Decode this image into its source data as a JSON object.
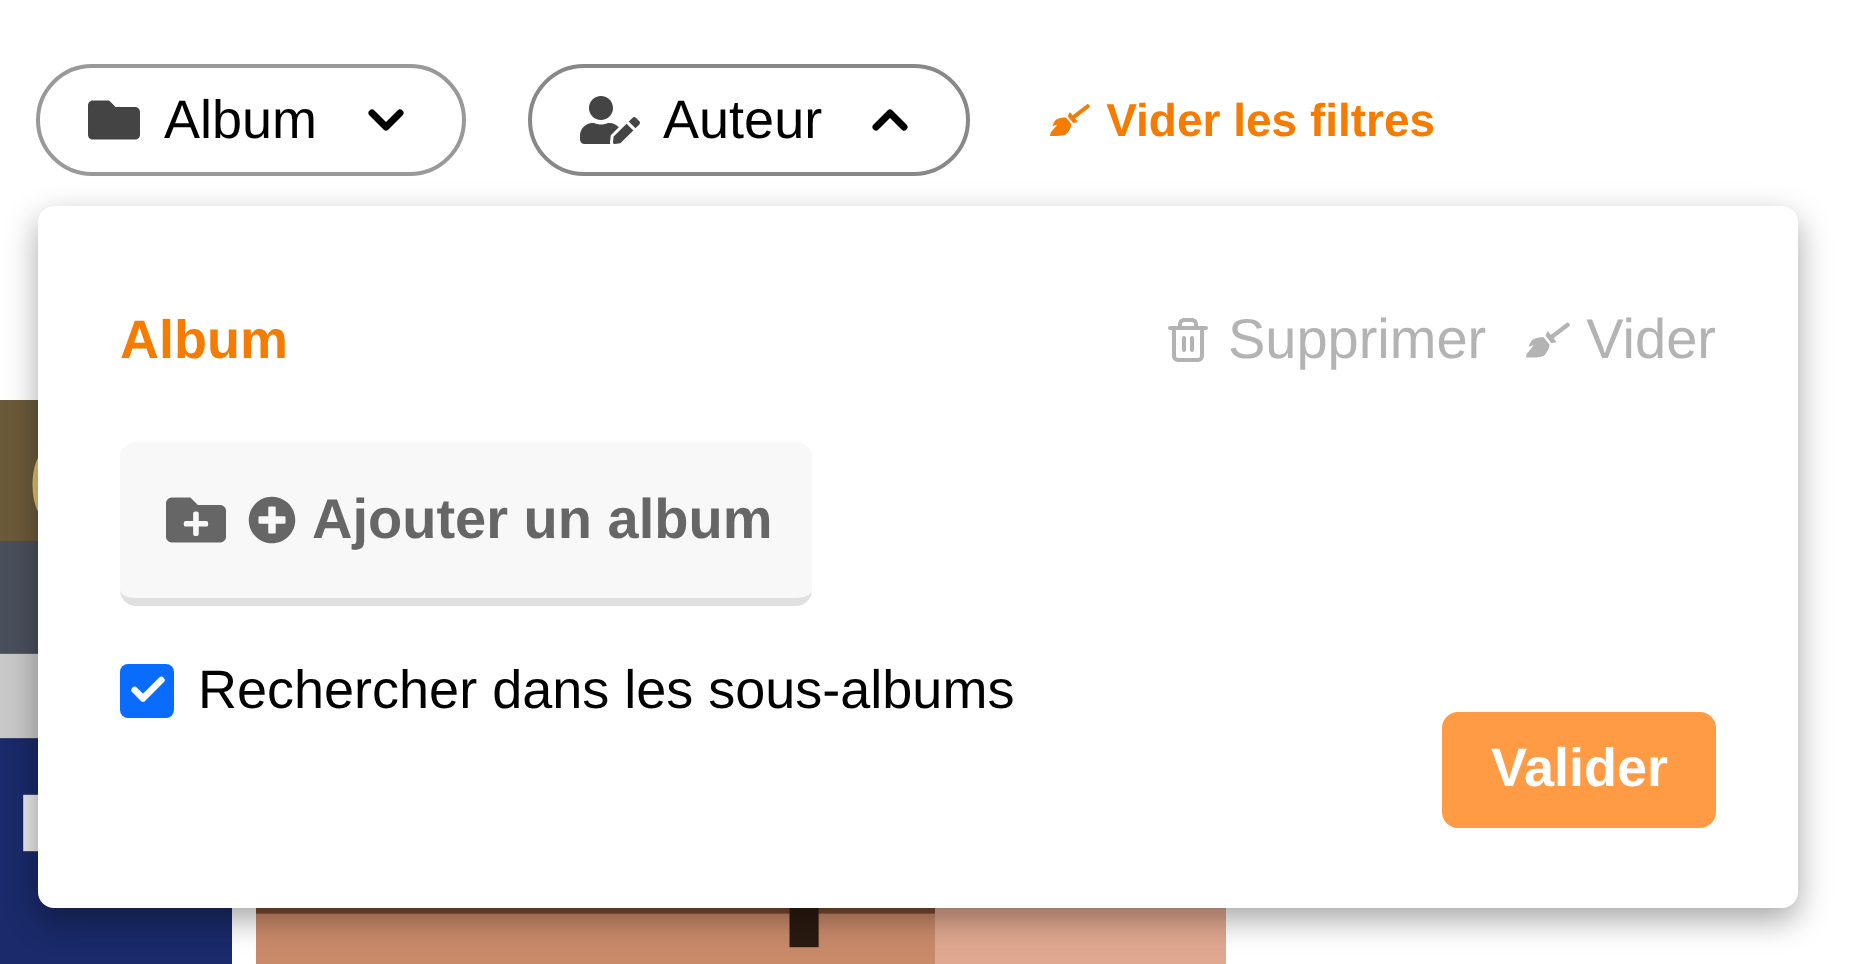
{
  "filters": [
    {
      "kind": "album",
      "label": "Album",
      "expanded": false
    },
    {
      "kind": "author",
      "label": "Auteur",
      "expanded": true
    }
  ],
  "clear_filters": "Vider les filtres",
  "popup": {
    "title": "Album",
    "actions": [
      {
        "kind": "delete",
        "label": "Supprimer",
        "disabled": true
      },
      {
        "kind": "clear",
        "label": "Vider",
        "disabled": true
      }
    ],
    "add_button": "Ajouter un album",
    "subalbums": {
      "label": "Rechercher dans les sous-albums",
      "checked": true
    },
    "submit": "Valider"
  }
}
